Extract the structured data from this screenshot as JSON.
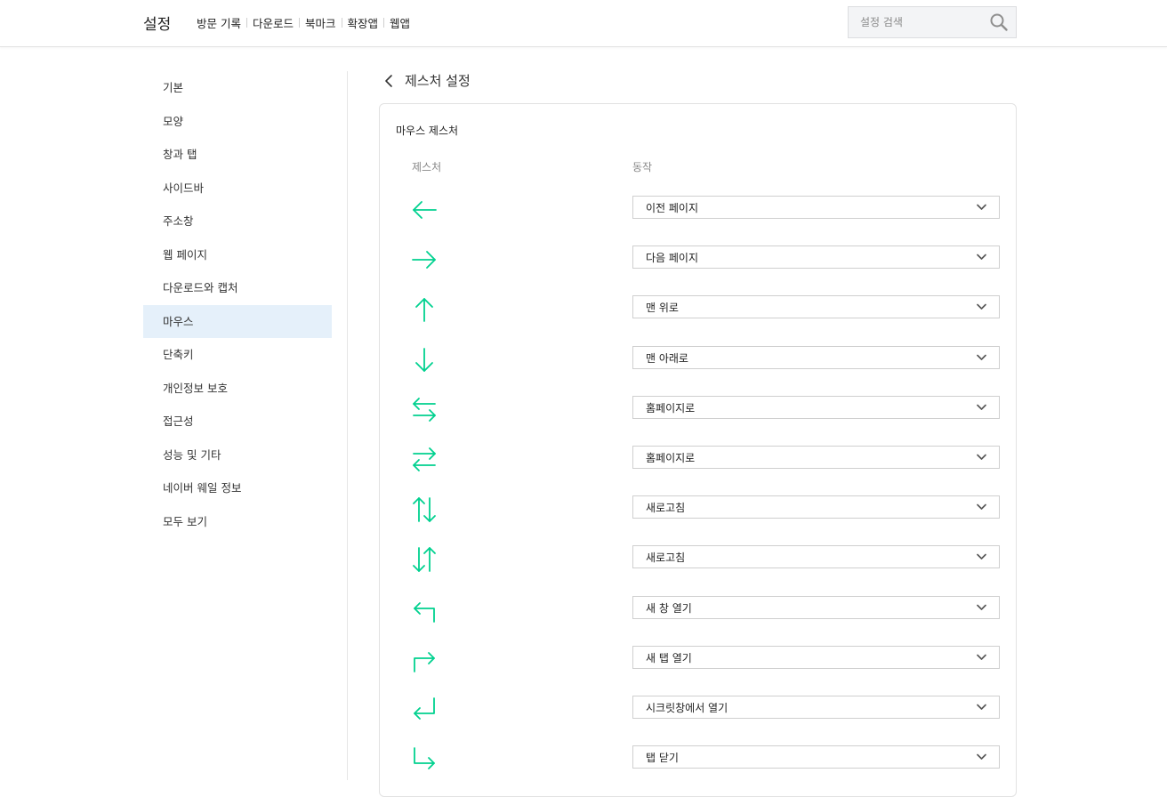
{
  "header": {
    "title": "설정",
    "nav": [
      "방문 기록",
      "다운로드",
      "북마크",
      "확장앱",
      "웹앱"
    ],
    "search_placeholder": "설정 검색"
  },
  "sidebar": {
    "items": [
      {
        "label": "기본"
      },
      {
        "label": "모양"
      },
      {
        "label": "창과 탭"
      },
      {
        "label": "사이드바"
      },
      {
        "label": "주소창"
      },
      {
        "label": "웹 페이지"
      },
      {
        "label": "다운로드와 캡처"
      },
      {
        "label": "마우스",
        "active": true
      },
      {
        "label": "단축키"
      },
      {
        "label": "개인정보 보호"
      },
      {
        "label": "접근성"
      },
      {
        "label": "성능 및 기타"
      },
      {
        "label": "네이버 웨일 정보"
      },
      {
        "label": "모두 보기"
      }
    ]
  },
  "main": {
    "page_title": "제스처 설정",
    "section_title": "마우스 제스처",
    "col_gesture": "제스처",
    "col_action": "동작",
    "gesture_color": "#00d18f",
    "rows": [
      {
        "icon": "arrow-left-icon",
        "action": "이전 페이지"
      },
      {
        "icon": "arrow-right-icon",
        "action": "다음 페이지"
      },
      {
        "icon": "arrow-up-icon",
        "action": "맨 위로"
      },
      {
        "icon": "arrow-down-icon",
        "action": "맨 아래로"
      },
      {
        "icon": "arrow-left-right-icon",
        "action": "홈페이지로"
      },
      {
        "icon": "arrow-right-left-icon",
        "action": "홈페이지로"
      },
      {
        "icon": "arrow-up-down-icon",
        "action": "새로고침"
      },
      {
        "icon": "arrow-down-up-icon",
        "action": "새로고침"
      },
      {
        "icon": "arrow-up-left-icon",
        "action": "새 창 열기"
      },
      {
        "icon": "arrow-up-right-icon",
        "action": "새 탭 열기"
      },
      {
        "icon": "arrow-down-left-icon",
        "action": "시크릿창에서 열기"
      },
      {
        "icon": "arrow-down-right-icon",
        "action": "탭 닫기"
      }
    ]
  }
}
